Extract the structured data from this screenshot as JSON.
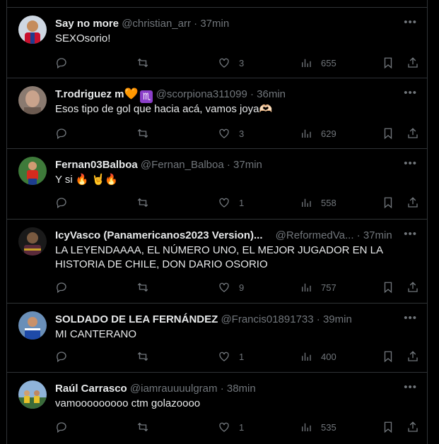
{
  "tweets": [
    {
      "name": "Say no more",
      "handle": "@christian_arr",
      "time": "37min",
      "text": "SEXOsorio!",
      "replies": "",
      "retweets": "",
      "likes": "3",
      "views": "655"
    },
    {
      "name": "T.rodriguez m",
      "name_emoji": "🧡",
      "badge": "♏",
      "handle": "@scorpiona311099",
      "time": "36min",
      "text": "Esos tipo de gol que hacia acá, vamos joya🫶🏻",
      "replies": "",
      "retweets": "",
      "likes": "3",
      "views": "629"
    },
    {
      "name": "Fernan03Balboa",
      "handle": "@Fernan_Balboa",
      "time": "37min",
      "text": "Y si 🔥 🤘🔥",
      "replies": "",
      "retweets": "",
      "likes": "1",
      "views": "558"
    },
    {
      "name": "IcyVasco (Panamericanos2023 Version)...",
      "handle": "@ReformedVa...",
      "time": "37min",
      "text": "LA LEYENDAAAA, EL NÚMERO UNO, EL MEJOR JUGADOR EN LA HISTORIA DE CHILE, DON DARIO OSORIO",
      "replies": "",
      "retweets": "",
      "likes": "9",
      "views": "757"
    },
    {
      "name": "SOLDADO DE LEA FERNÁNDEZ",
      "handle": "@Francis01891733",
      "time": "39min",
      "text": "MI CANTERANO",
      "replies": "",
      "retweets": "",
      "likes": "1",
      "views": "400"
    },
    {
      "name": "Raúl Carrasco",
      "handle": "@iamrauuuulgram",
      "time": "38min",
      "text": "vamooooooooo ctm golazoooo",
      "replies": "",
      "retweets": "",
      "likes": "1",
      "views": "535"
    }
  ],
  "separator": "·",
  "icons": {
    "more": "more-horizontal-icon",
    "reply": "reply-bubble-icon",
    "retweet": "retweet-arrows-icon",
    "like": "heart-outline-icon",
    "views": "bar-chart-icon",
    "bookmark": "bookmark-icon",
    "share": "share-upload-icon"
  }
}
